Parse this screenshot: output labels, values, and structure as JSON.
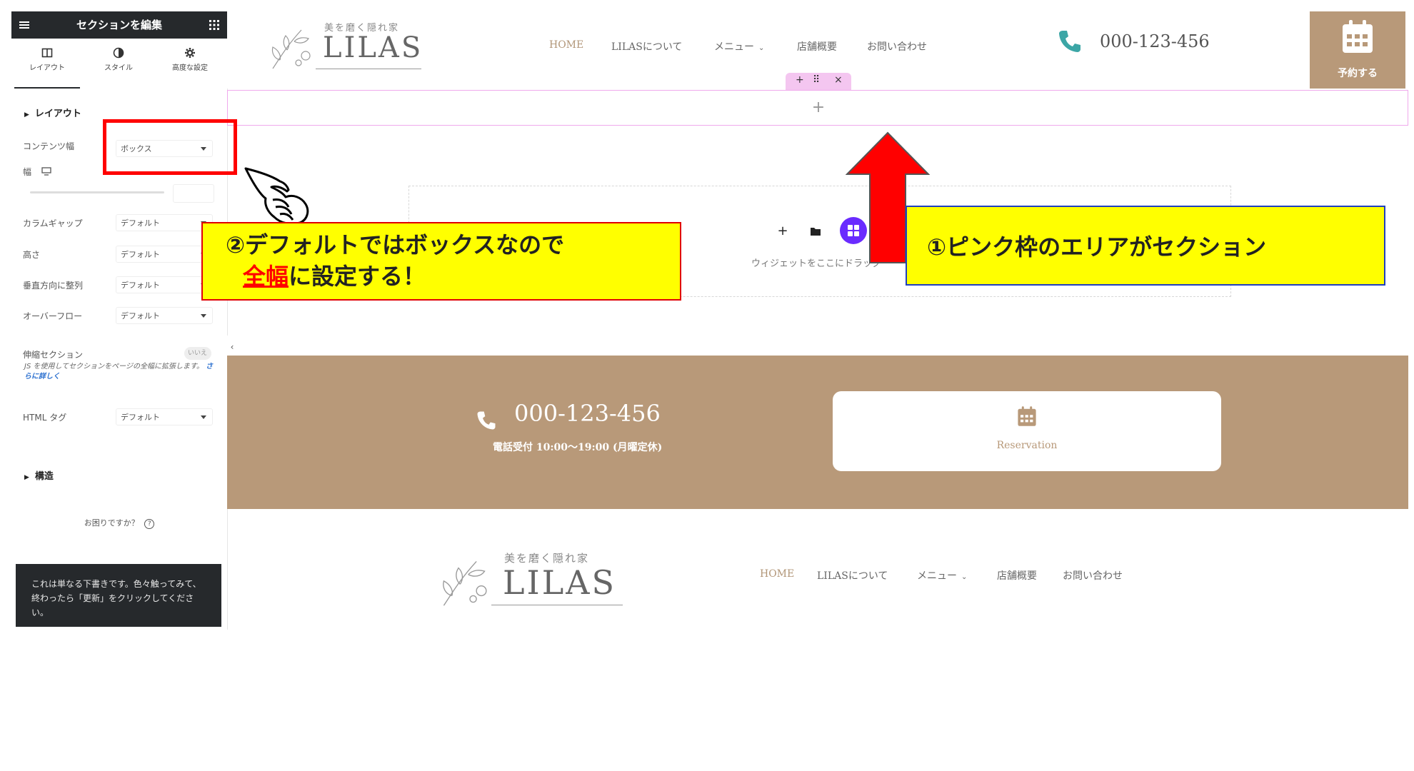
{
  "panel": {
    "title": "セクションを編集",
    "tabs": [
      {
        "label": "レイアウト",
        "icon": "layout-icon"
      },
      {
        "label": "スタイル",
        "icon": "contrast-icon"
      },
      {
        "label": "高度な設定",
        "icon": "gear-icon"
      }
    ],
    "layout_section": "レイアウト",
    "controls": {
      "content_width": {
        "label": "コンテンツ幅",
        "value": "ボックス"
      },
      "width": {
        "label": "幅"
      },
      "column_gap": {
        "label": "カラムギャップ",
        "value": "デフォルト"
      },
      "height": {
        "label": "高さ",
        "value": "デフォルト"
      },
      "vertical_align": {
        "label": "垂直方向に整列",
        "value": "デフォルト"
      },
      "overflow": {
        "label": "オーバーフロー",
        "value": "デフォルト"
      },
      "stretch": {
        "label": "伸縮セクション",
        "toggle": "いいえ"
      },
      "html_tag": {
        "label": "HTML タグ",
        "value": "デフォルト"
      }
    },
    "stretch_note": "JS を使用してセクションをページの全幅に拡張します。",
    "stretch_link": "さらに詳しく",
    "structure_section": "構造",
    "help": "お困りですか？",
    "draft_note": "これは単なる下書きです。色々触ってみて、終わったら「更新」をクリックしてください。"
  },
  "site": {
    "logo_tagline": "美を磨く隠れ家",
    "logo_name": "LILAS",
    "nav": [
      "HOME",
      "LILASについて",
      "メニュー",
      "店舗概要",
      "お問い合わせ"
    ],
    "phone": "000-123-456",
    "book_label": "予約する",
    "section_toolbar": [
      "+",
      "⠿",
      "×"
    ],
    "add_plus": "+",
    "drop_text": "ウィジェットをここにドラッグ",
    "cta_phone": "000-123-456",
    "cta_hours": "電話受付 10:00〜19:00 (月曜定休)",
    "reserve_label": "Reservation"
  },
  "annotations": {
    "note1": "①ピンク枠のエリアがセクション",
    "note2_line1": "②デフォルトではボックスなので",
    "note2_em": "全幅",
    "note2_rest": "に設定する！"
  },
  "colors": {
    "brand": "#b89979",
    "accent_pink": "#f0a9ec",
    "editor_dark": "#26292c",
    "annotation_red": "#ff0000",
    "annotation_yellow": "#ffff00"
  }
}
